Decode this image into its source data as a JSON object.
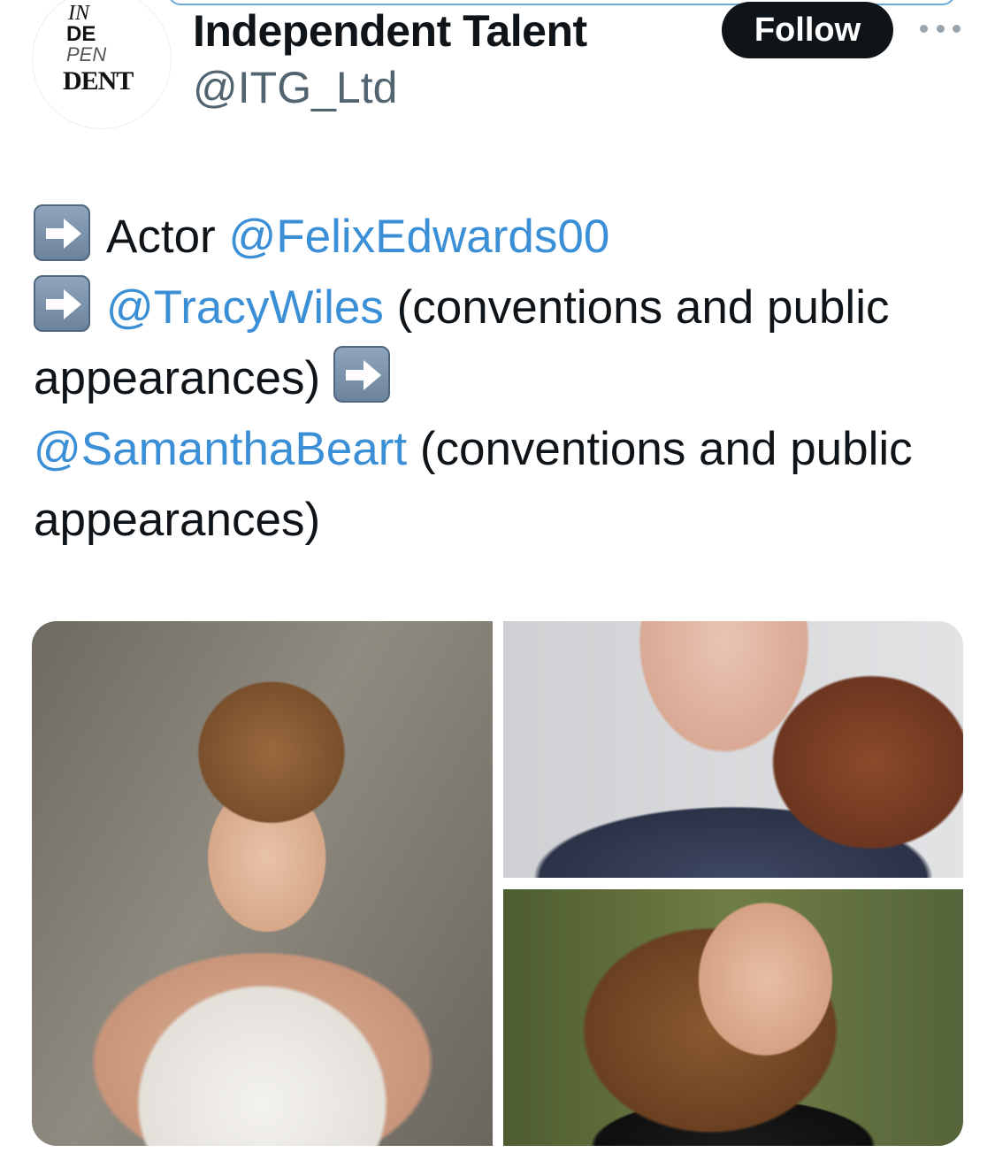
{
  "author": {
    "avatar_logo": {
      "line1": "IN",
      "line2": "DE",
      "line3": "PEN",
      "line4": "DENT"
    },
    "display_name": "Independent Talent",
    "handle": "@ITG_Ltd"
  },
  "actions": {
    "follow_label": "Follow",
    "more_icon": "more-horizontal-icon"
  },
  "tweet": {
    "segments": [
      {
        "type": "emoji",
        "icon": "right-arrow-emoji"
      },
      {
        "type": "text",
        "value": "Actor "
      },
      {
        "type": "mention",
        "value": "@FelixEdwards00"
      },
      {
        "type": "break"
      },
      {
        "type": "emoji",
        "icon": "right-arrow-emoji"
      },
      {
        "type": "mention",
        "value": "@TracyWiles"
      },
      {
        "type": "text",
        "value": " (conventions and public appearances) "
      },
      {
        "type": "emoji",
        "icon": "right-arrow-emoji"
      },
      {
        "type": "break"
      },
      {
        "type": "mention",
        "value": "@SamanthaBeart"
      },
      {
        "type": "text",
        "value": " (conventions and public appearances)"
      }
    ]
  },
  "media": {
    "photos": [
      {
        "subject": "young man with tousled brown hair in white tank top"
      },
      {
        "subject": "woman with auburn hair in sparkly navy top"
      },
      {
        "subject": "woman with wavy brown hair against green background"
      }
    ]
  },
  "colors": {
    "mention": "#3a8fd6",
    "follow_bg": "#0f1419",
    "text": "#0f1419",
    "handle": "#536471"
  }
}
